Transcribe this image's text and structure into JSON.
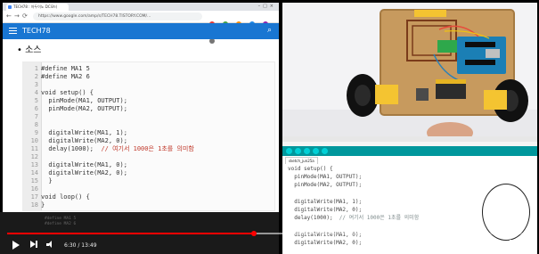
{
  "browser": {
    "tab_title": "TECH78 : 아두이노 DC모터",
    "address": "https://www.google.com/amp/s/TECH78.TISTORY.COM/...",
    "site_title": "TECH78"
  },
  "blog": {
    "heading": "소스"
  },
  "code": [
    {
      "n": "1",
      "text": "#define MA1 5",
      "comment": ""
    },
    {
      "n": "2",
      "text": "#define MA2 6",
      "comment": ""
    },
    {
      "n": "3",
      "text": "",
      "comment": ""
    },
    {
      "n": "4",
      "text": "void setup() {",
      "comment": ""
    },
    {
      "n": "5",
      "text": "  pinMode(MA1, OUTPUT);",
      "comment": ""
    },
    {
      "n": "6",
      "text": "  pinMode(MA2, OUTPUT);",
      "comment": ""
    },
    {
      "n": "7",
      "text": "",
      "comment": ""
    },
    {
      "n": "8",
      "text": "",
      "comment": ""
    },
    {
      "n": "9",
      "text": "  digitalWrite(MA1, 1);",
      "comment": ""
    },
    {
      "n": "10",
      "text": "  digitalWrite(MA2, 0);",
      "comment": ""
    },
    {
      "n": "11",
      "text": "  delay(1000);  ",
      "comment": "// 여기서 1000은 1초를 의미함"
    },
    {
      "n": "12",
      "text": "",
      "comment": ""
    },
    {
      "n": "13",
      "text": "  digitalWrite(MA1, 0);",
      "comment": ""
    },
    {
      "n": "14",
      "text": "  digitalWrite(MA2, 0);",
      "comment": ""
    },
    {
      "n": "15",
      "text": "  }",
      "comment": ""
    },
    {
      "n": "16",
      "text": "",
      "comment": ""
    },
    {
      "n": "17",
      "text": "void loop() {",
      "comment": ""
    },
    {
      "n": "18",
      "text": "}",
      "comment": ""
    }
  ],
  "caption_lines": [
    "#define MA1 5",
    "#define MA2 6"
  ],
  "ide": {
    "tab": "sketch_jun25a",
    "lines": [
      {
        "text": "void setup() {",
        "comment": ""
      },
      {
        "text": "  pinMode(MA1, OUTPUT);",
        "comment": ""
      },
      {
        "text": "  pinMode(MA2, OUTPUT);",
        "comment": ""
      },
      {
        "text": "",
        "comment": ""
      },
      {
        "text": "  digitalWrite(MA1, 1);",
        "comment": ""
      },
      {
        "text": "  digitalWrite(MA2, 0);",
        "comment": ""
      },
      {
        "text": "  delay(1000);  ",
        "comment": "// 여기서 1000은 1초를 의미함"
      },
      {
        "text": "",
        "comment": ""
      },
      {
        "text": "  digitalWrite(MA1, 0);",
        "comment": ""
      },
      {
        "text": "  digitalWrite(MA2, 0);",
        "comment": ""
      }
    ]
  },
  "player": {
    "time": "6:30 / 13:49",
    "progress": 0.47,
    "buffered": 0.55,
    "cc_label": "CC"
  },
  "colors": {
    "progress": "#ff0000",
    "blog_header": "#1976d2",
    "arduino_teal": "#00979c"
  }
}
